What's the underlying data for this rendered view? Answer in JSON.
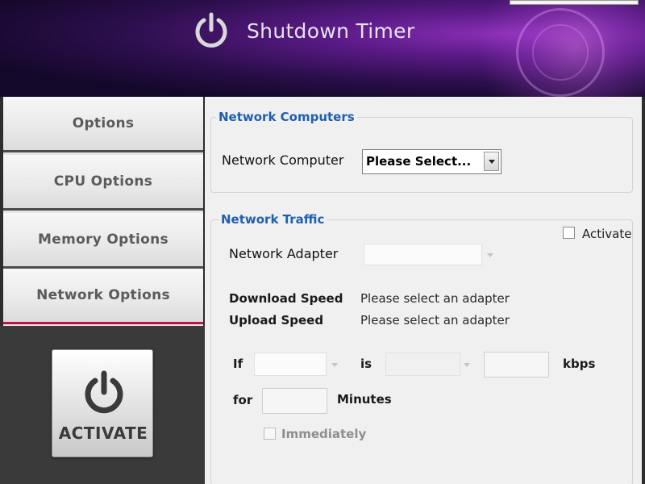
{
  "app": {
    "title": "Shutdown Timer"
  },
  "nav": {
    "items": [
      {
        "label": "Options"
      },
      {
        "label": "CPU Options"
      },
      {
        "label": "Memory Options"
      },
      {
        "label": "Network Options"
      }
    ],
    "activate_label": "ACTIVATE"
  },
  "network_computers": {
    "legend": "Network Computers",
    "label": "Network Computer",
    "select_value": "Please Select..."
  },
  "network_traffic": {
    "legend": "Network Traffic",
    "activate_checkbox_label": "Activate",
    "activate_checked": false,
    "adapter_label": "Network Adapter",
    "adapter_value": "",
    "download_label": "Download Speed",
    "download_value": "Please select an adapter",
    "upload_label": "Upload Speed",
    "upload_value": "Please select an adapter",
    "if_label": "If",
    "is_label": "is",
    "kbps_label": "kbps",
    "for_label": "for",
    "minutes_label": "Minutes",
    "immediately_label": "Immediately",
    "immediately_checked": false
  },
  "icons": {
    "logo": "power-icon",
    "activate": "power-icon",
    "dropdown": "chevron-down-icon"
  },
  "colors": {
    "legend": "#1f5fb0",
    "active_tab_underline": "#c0134a",
    "header_purple": "#5a1a86"
  }
}
